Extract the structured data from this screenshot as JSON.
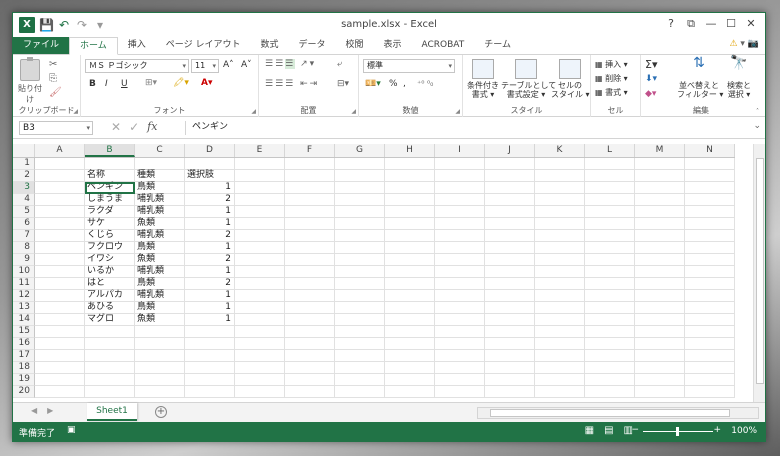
{
  "window": {
    "title": "sample.xlsx - Excel",
    "logo": "X"
  },
  "titlebar": {
    "help": "?",
    "ribbon_opts": "⧉",
    "minimize": "—",
    "maximize": "☐",
    "close": "✕"
  },
  "tabs": [
    "ファイル",
    "ホーム",
    "挿入",
    "ページ レイアウト",
    "数式",
    "データ",
    "校閲",
    "表示",
    "ACROBAT",
    "チーム"
  ],
  "active_tab": "ホーム",
  "ribbon": {
    "clipboard": {
      "label": "クリップボード",
      "paste": "貼り付け"
    },
    "font": {
      "label": "フォント",
      "name": "ＭＳ Ｐゴシック",
      "size": "11",
      "grow": "A˄",
      "shrink": "A˅",
      "bold": "B",
      "italic": "I",
      "underline": "U"
    },
    "alignment": {
      "label": "配置"
    },
    "number": {
      "label": "数値",
      "format": "標準",
      "percent": "%",
      "comma": ","
    },
    "styles": {
      "label": "スタイル",
      "cond": "条件付き\n書式 ▾",
      "table": "テーブルとして\n書式設定 ▾",
      "cell": "セルの\nスタイル ▾"
    },
    "cells": {
      "label": "セル",
      "insert": "挿入 ▾",
      "delete": "削除 ▾",
      "format": "書式 ▾"
    },
    "editing": {
      "label": "編集",
      "sort": "並べ替えと\nフィルター ▾",
      "find": "検索と\n選択 ▾"
    }
  },
  "formula_bar": {
    "name_box": "B3",
    "formula": "ペンギン"
  },
  "columns": [
    "A",
    "B",
    "C",
    "D",
    "E",
    "F",
    "G",
    "H",
    "I",
    "J",
    "K",
    "L",
    "M",
    "N"
  ],
  "rows": [
    [
      "",
      "",
      "",
      ""
    ],
    [
      "",
      "名称",
      "種類",
      "選択肢"
    ],
    [
      "",
      "ペンギン",
      "鳥類",
      "1"
    ],
    [
      "",
      "しまうま",
      "哺乳類",
      "2"
    ],
    [
      "",
      "ラクダ",
      "哺乳類",
      "1"
    ],
    [
      "",
      "サケ",
      "魚類",
      "1"
    ],
    [
      "",
      "くじら",
      "哺乳類",
      "2"
    ],
    [
      "",
      "フクロウ",
      "鳥類",
      "1"
    ],
    [
      "",
      "イワシ",
      "魚類",
      "2"
    ],
    [
      "",
      "いるか",
      "哺乳類",
      "1"
    ],
    [
      "",
      "はと",
      "鳥類",
      "2"
    ],
    [
      "",
      "アルパカ",
      "哺乳類",
      "1"
    ],
    [
      "",
      "あひる",
      "鳥類",
      "1"
    ],
    [
      "",
      "マグロ",
      "魚類",
      "1"
    ],
    [
      "",
      "",
      "",
      ""
    ],
    [
      "",
      "",
      "",
      ""
    ],
    [
      "",
      "",
      "",
      ""
    ],
    [
      "",
      "",
      "",
      ""
    ],
    [
      "",
      "",
      "",
      ""
    ],
    [
      "",
      "",
      "",
      ""
    ]
  ],
  "active_cell": {
    "row": 3,
    "col": "B"
  },
  "sheets": [
    "Sheet1"
  ],
  "status": {
    "ready": "準備完了",
    "zoom": "100%"
  }
}
